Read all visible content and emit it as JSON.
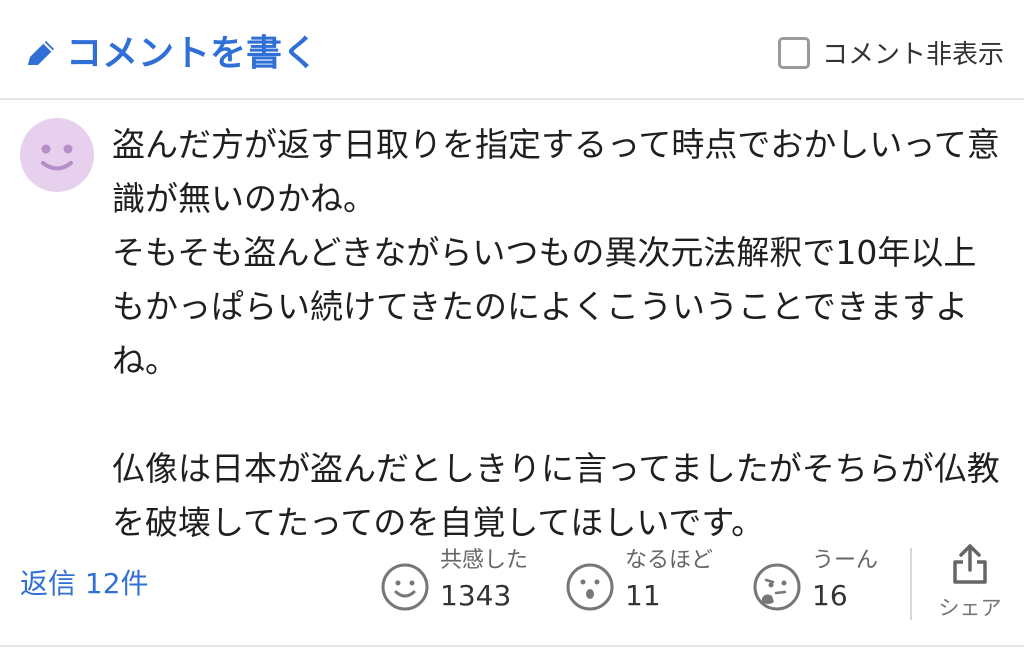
{
  "header": {
    "write_comment_label": "コメントを書く",
    "hide_comments_label": "コメント非表示",
    "hide_comments_checked": false
  },
  "comment": {
    "avatar_icon": "smiley-face-avatar",
    "avatar_color": "#e7cfee",
    "text": "盗んだ方が返す日取りを指定するって時点でおかしいって意識が無いのかね。\nそもそも盗んどきながらいつもの異次元法解釈で10年以上もかっぱらい続けてきたのによくこういうことできますよね。\n\n仏像は日本が盗んだとしきりに言ってましたがそちらが仏教を破壊してたってのを自覚してほしいです。"
  },
  "footer": {
    "replies_label": "返信 12件",
    "reactions": [
      {
        "label": "共感した",
        "count": "1343",
        "icon": "smile-face-icon"
      },
      {
        "label": "なるほど",
        "count": "11",
        "icon": "surprised-face-icon"
      },
      {
        "label": "うーん",
        "count": "16",
        "icon": "thinking-face-icon"
      }
    ],
    "share_label": "シェア"
  },
  "colors": {
    "accent": "#2f6fd6",
    "text": "#1f1f1f",
    "muted": "#777777"
  }
}
